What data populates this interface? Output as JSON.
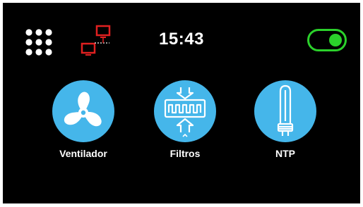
{
  "status_bar": {
    "menu_icon": "grid-menu-icon",
    "network_icon": "network-disconnected-icon",
    "network_icon_color": "#e02020",
    "time": "15:43",
    "toggle_state": "on",
    "toggle_color": "#2bd12b"
  },
  "tiles": [
    {
      "label": "Ventilador",
      "icon": "fan-icon"
    },
    {
      "label": "Filtros",
      "icon": "filter-icon"
    },
    {
      "label": "NTP",
      "icon": "uv-lamp-icon"
    }
  ],
  "colors": {
    "background": "#000000",
    "tile_circle": "#45b6ea",
    "text": "#ffffff"
  }
}
